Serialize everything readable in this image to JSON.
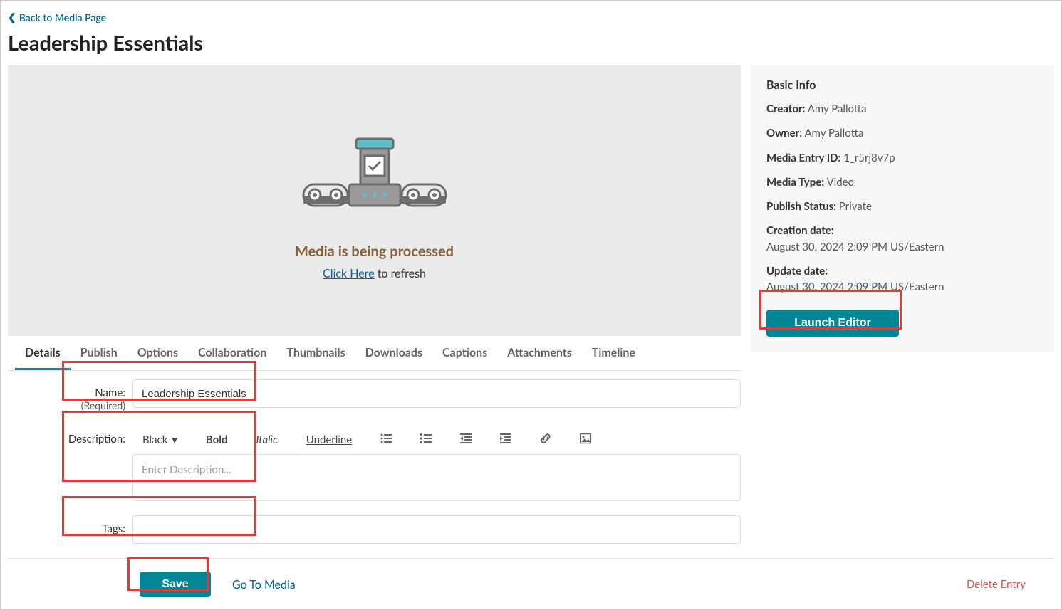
{
  "back_link": "Back to Media Page",
  "page_title": "Leadership Essentials",
  "preview": {
    "processing_title": "Media is being processed",
    "refresh_link": "Click Here",
    "refresh_suffix": " to refresh"
  },
  "tabs": [
    "Details",
    "Publish",
    "Options",
    "Collaboration",
    "Thumbnails",
    "Downloads",
    "Captions",
    "Attachments",
    "Timeline"
  ],
  "active_tab_index": 0,
  "form": {
    "name_label": "Name:",
    "name_required": "(Required)",
    "name_value": "Leadership Essentials",
    "desc_label": "Description:",
    "desc_placeholder": "Enter Description...",
    "tags_label": "Tags:",
    "tags_value": ""
  },
  "wysiwyg": {
    "color": "Black",
    "bold": "Bold",
    "italic": "Italic",
    "underline": "Underline"
  },
  "sidebar": {
    "heading": "Basic Info",
    "creator_label": "Creator:",
    "creator_value": "Amy Pallotta",
    "owner_label": "Owner:",
    "owner_value": "Amy Pallotta",
    "entry_id_label": "Media Entry ID:",
    "entry_id_value": "1_r5rj8v7p",
    "media_type_label": "Media Type:",
    "media_type_value": "Video",
    "publish_status_label": "Publish Status:",
    "publish_status_value": "Private",
    "creation_label": "Creation date:",
    "creation_value": "August 30, 2024 2:09 PM US/Eastern",
    "update_label": "Update date:",
    "update_value": "August 30, 2024 2:09 PM US/Eastern",
    "launch_button": "Launch Editor"
  },
  "footer": {
    "save": "Save",
    "go_to_media": "Go To Media",
    "delete": "Delete Entry"
  }
}
